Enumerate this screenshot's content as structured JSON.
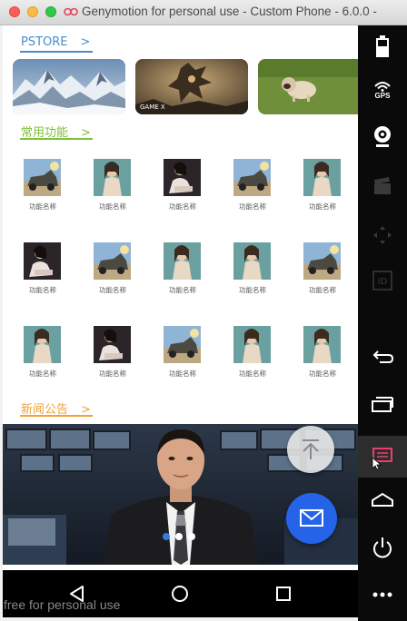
{
  "window": {
    "title": "Genymotion for personal use - Custom Phone - 6.0.0 -"
  },
  "sections": {
    "pstore": {
      "title": "PSTORE",
      "arrow": ">",
      "color": "#4a8ec7"
    },
    "features": {
      "title": "常用功能",
      "arrow": ">",
      "color": "#7dbf3b"
    },
    "news": {
      "title": "新闻公告",
      "arrow": ">",
      "color": "#f0a23a"
    }
  },
  "store_cards": [
    {
      "name": "snowy-mountain-card",
      "caption": ""
    },
    {
      "name": "game-art-card",
      "caption": "GAME X"
    },
    {
      "name": "pug-dog-card",
      "caption": ""
    }
  ],
  "features": [
    {
      "label": "功能名称",
      "thumb": "vehicle"
    },
    {
      "label": "功能名称",
      "thumb": "woman"
    },
    {
      "label": "功能名称",
      "thumb": "woman-dark"
    },
    {
      "label": "功能名称",
      "thumb": "vehicle"
    },
    {
      "label": "功能名称",
      "thumb": "woman"
    },
    {
      "label": "功能名称",
      "thumb": "woman-dark"
    },
    {
      "label": "功能名称",
      "thumb": "vehicle"
    },
    {
      "label": "功能名称",
      "thumb": "woman"
    },
    {
      "label": "功能名称",
      "thumb": "woman"
    },
    {
      "label": "功能名称",
      "thumb": "vehicle"
    },
    {
      "label": "功能名称",
      "thumb": "woman"
    },
    {
      "label": "功能名称",
      "thumb": "woman-dark"
    },
    {
      "label": "功能名称",
      "thumb": "vehicle"
    },
    {
      "label": "功能名称",
      "thumb": "woman"
    },
    {
      "label": "功能名称",
      "thumb": "woman"
    }
  ],
  "carousel": {
    "total": 3,
    "active_index": 0,
    "active_color": "#2f7de1",
    "inactive_color": "#ffffff"
  },
  "sidebar": {
    "gps_label": "GPS",
    "id_label": "ID"
  },
  "watermark": "free for personal use"
}
